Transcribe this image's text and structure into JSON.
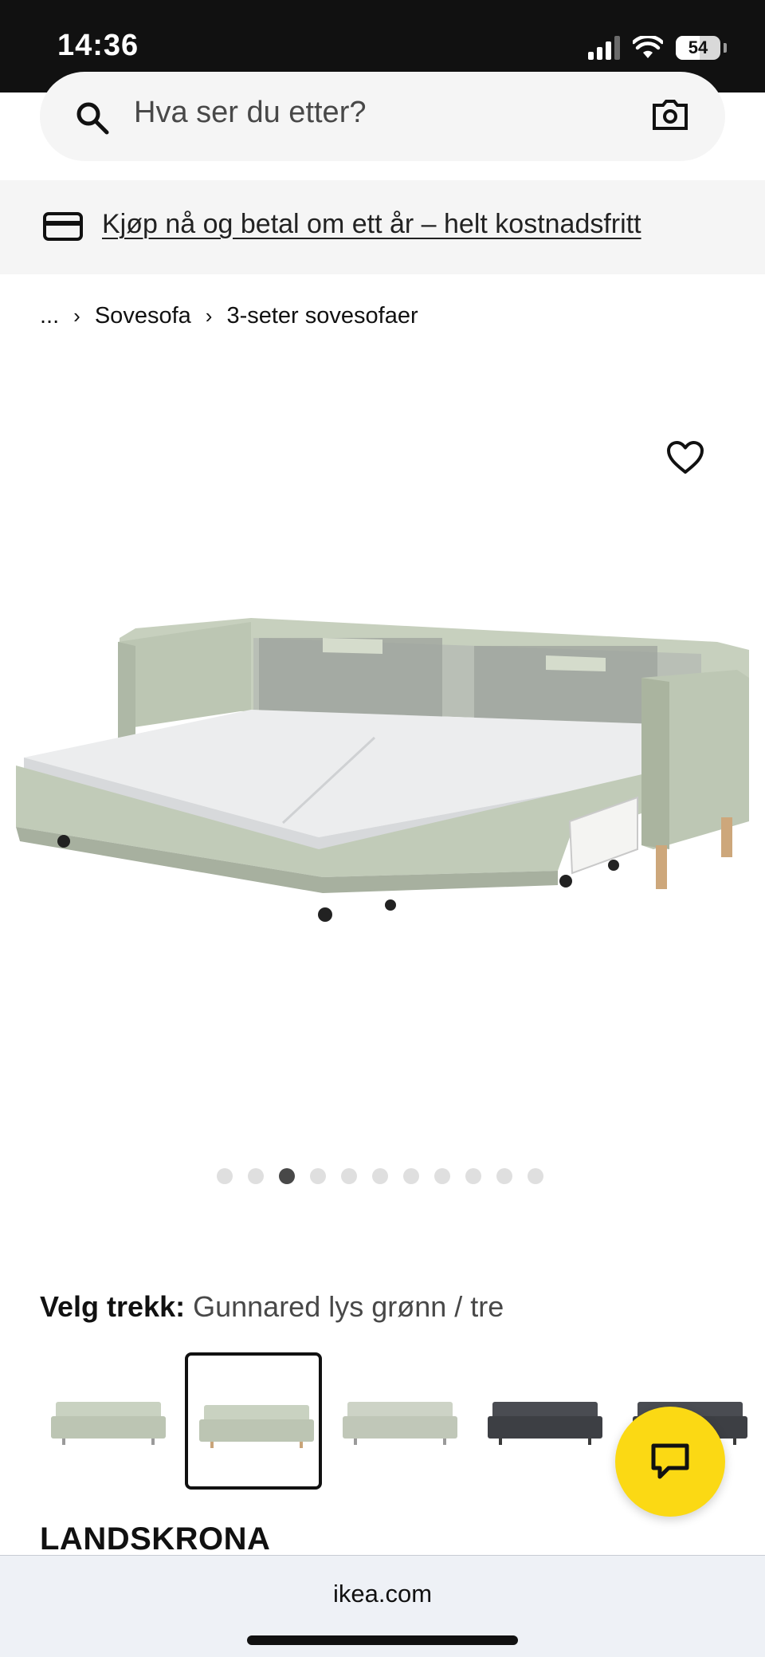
{
  "status_bar": {
    "time": "14:36",
    "battery": "54",
    "battery_level": 0.54
  },
  "search": {
    "placeholder": "Hva ser du etter?"
  },
  "banner": {
    "text": "Kjøp nå og betal om ett år – helt kostnadsfritt"
  },
  "breadcrumb": {
    "items": [
      "...",
      "Sovesofa",
      "3-seter sovesofaer"
    ]
  },
  "gallery": {
    "total_images": 11,
    "active_index": 2
  },
  "variant": {
    "label": "Velg trekk:",
    "value": "Gunnared lys grønn / tre",
    "swatches": [
      {
        "color": "#c9d2c1",
        "legs": "#9a9a9a"
      },
      {
        "color": "#c9d2c1",
        "legs": "#c9a479",
        "selected": true
      },
      {
        "color": "#cdd3c6",
        "legs": "#9a9a9a"
      },
      {
        "color": "#4a4c52",
        "legs": "#3a3a3a"
      },
      {
        "color": "#4a4c52",
        "legs": "#3a3a3a"
      }
    ]
  },
  "product": {
    "name": "LANDSKRONA"
  },
  "browser": {
    "url": "ikea.com"
  },
  "colors": {
    "chat": "#fbd914",
    "sofa": "#c5cfbd"
  }
}
